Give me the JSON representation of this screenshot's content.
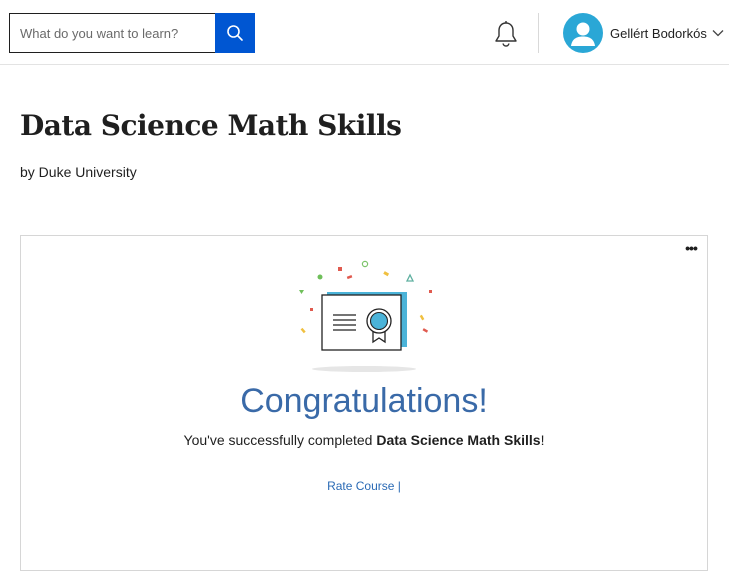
{
  "header": {
    "search": {
      "placeholder": "What do you want to learn?",
      "value": ""
    },
    "user": {
      "name": "Gellért Bodorkós"
    }
  },
  "course": {
    "title": "Data Science Math Skills",
    "byline": "by Duke University"
  },
  "card": {
    "more_label": "•••",
    "congrats": "Congratulations!",
    "completed_prefix": "You've successfully completed ",
    "completed_course": "Data Science Math Skills",
    "completed_suffix": "!",
    "rate_label": "Rate Course",
    "rate_sep": " |"
  },
  "colors": {
    "accent": "#0056d2",
    "avatar": "#2aa7d6",
    "congrats": "#3a6aa8",
    "link": "#2a6ab5"
  },
  "icons": [
    "search-icon",
    "bell-icon",
    "user-avatar-icon",
    "chevron-down-icon",
    "more-options-icon",
    "certificate-icon"
  ]
}
